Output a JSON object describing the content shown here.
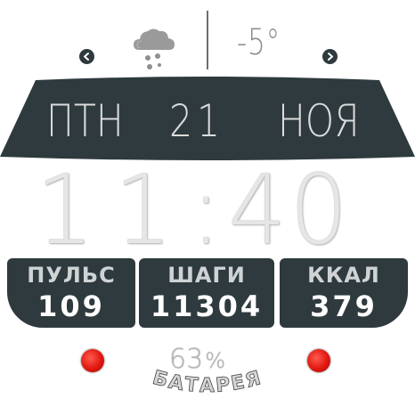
{
  "weather": {
    "icon": "cloud-snow-icon",
    "temperature": "-5°"
  },
  "nav": {
    "left_icon": "chevron-left-icon",
    "right_icon": "chevron-right-icon"
  },
  "date": {
    "weekday": "ПТН",
    "day": "21",
    "month": "НОЯ"
  },
  "time": {
    "hours": "11",
    "separator": ":",
    "minutes": "40"
  },
  "stats": {
    "pulse": {
      "label": "ПУЛЬС",
      "value": "109"
    },
    "steps": {
      "label": "ШАГИ",
      "value": "11304"
    },
    "calories": {
      "label": "ККАЛ",
      "value": "379"
    }
  },
  "battery": {
    "value": "63",
    "unit": "%",
    "label": "БАТАРЕЯ"
  },
  "colors": {
    "panel": "#2e3a3e",
    "indicator_red": "#e01810",
    "text_light": "#dcdcdc"
  }
}
